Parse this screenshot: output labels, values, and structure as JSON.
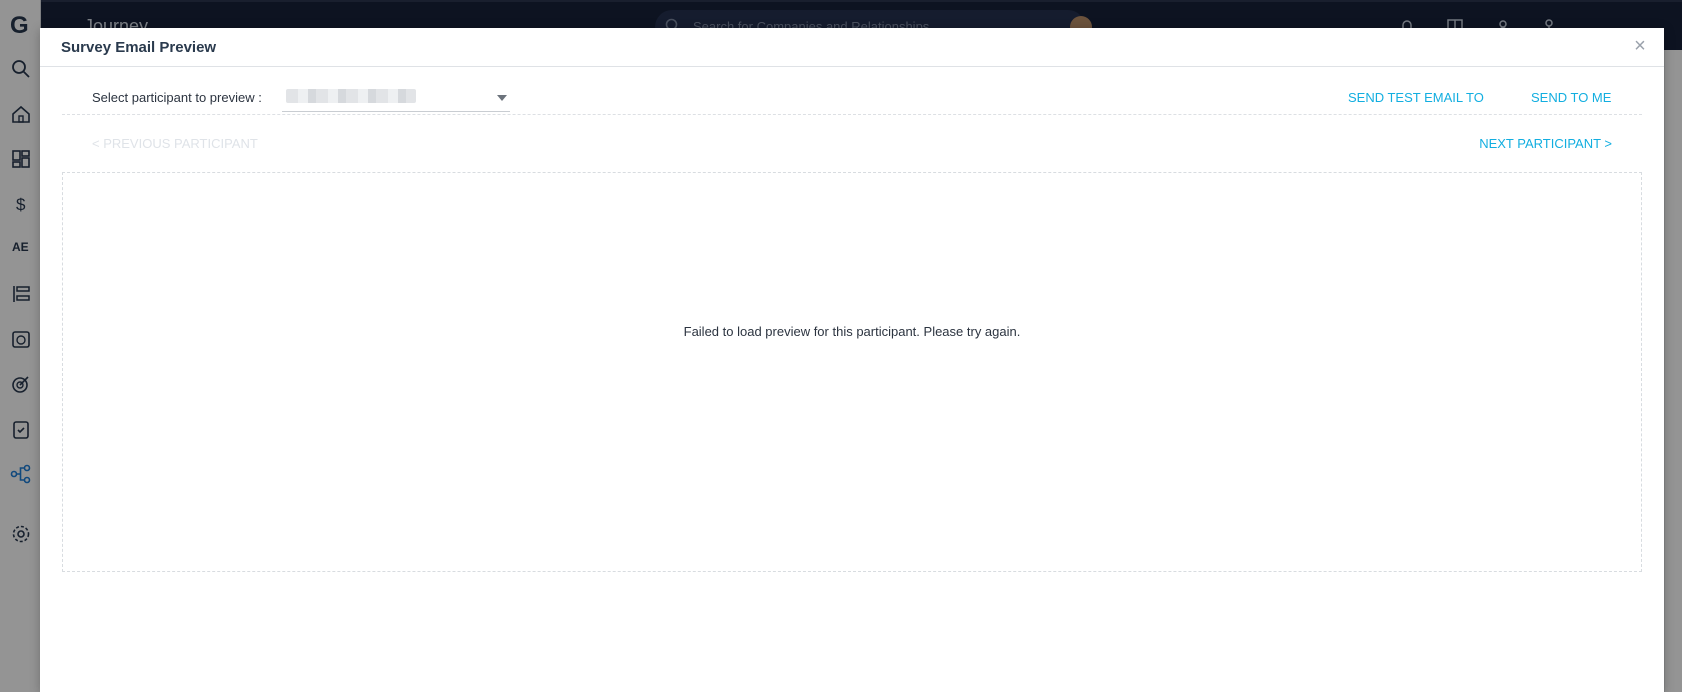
{
  "app": {
    "title": "Journey",
    "search_placeholder": "Search for Companies and Relationships",
    "logo": "G",
    "nav_ae": "AE"
  },
  "modal": {
    "title": "Survey Email Preview",
    "close_symbol": "×",
    "select_label": "Select participant to preview :",
    "send_test_label": "SEND TEST EMAIL TO",
    "send_me_label": "SEND TO ME",
    "prev_label": "< PREVIOUS PARTICIPANT",
    "next_label": "NEXT PARTICIPANT >",
    "preview_message": "Failed to load preview for this participant. Please try again."
  },
  "colors": {
    "accent": "#12aee0",
    "header_bg": "#17223a",
    "text": "#2c3440"
  },
  "icons": {
    "nav": [
      "search-icon",
      "home-icon",
      "dashboard-icon",
      "dollar-icon",
      "timeline-icon",
      "calendar-icon",
      "target-icon",
      "checklist-icon",
      "journey-icon",
      "gear-icon"
    ],
    "top": [
      "bell-icon",
      "book-icon",
      "people-icon",
      "user-icon"
    ]
  }
}
